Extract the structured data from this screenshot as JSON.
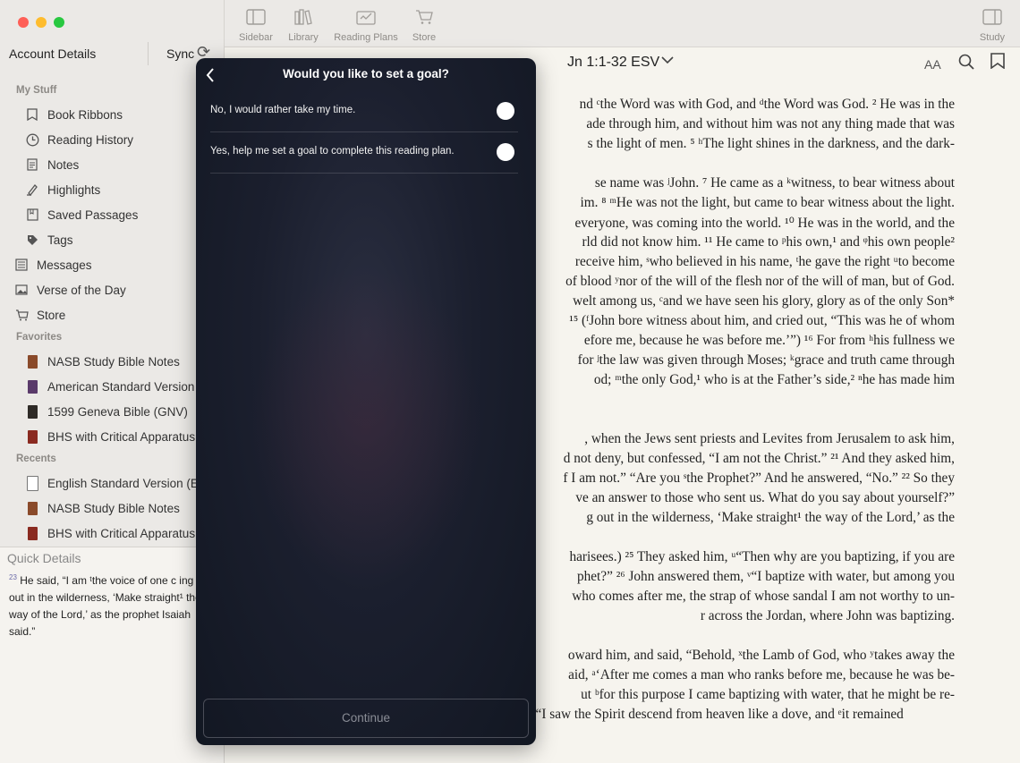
{
  "window": {
    "colors": {
      "close": "#fe5f57",
      "minimize": "#febc2e",
      "zoom": "#28c840"
    }
  },
  "sidebar": {
    "account_label": "Account Details",
    "sync_label": "Sync",
    "my_stuff_heading": "My Stuff",
    "my_stuff": [
      {
        "label": "Book Ribbons",
        "icon": "bookmark-icon"
      },
      {
        "label": "Reading History",
        "icon": "clock-icon"
      },
      {
        "label": "Notes",
        "icon": "notes-icon"
      },
      {
        "label": "Highlights",
        "icon": "highlighter-icon"
      },
      {
        "label": "Saved Passages",
        "icon": "saved-passage-icon"
      },
      {
        "label": "Tags",
        "icon": "tag-icon"
      }
    ],
    "top_items": [
      {
        "label": "Messages",
        "icon": "messages-icon"
      },
      {
        "label": "Verse of the Day",
        "icon": "image-icon"
      },
      {
        "label": "Store",
        "icon": "cart-icon"
      }
    ],
    "favorites_heading": "Favorites",
    "favorites": [
      {
        "label": "NASB Study Bible Notes",
        "color": "#8a4a2a"
      },
      {
        "label": "American Standard Version (A",
        "color": "#5a3a6a"
      },
      {
        "label": "1599 Geneva Bible (GNV)",
        "color": "#2e2a26"
      },
      {
        "label": "BHS with Critical Apparatus a",
        "color": "#8a2a20"
      }
    ],
    "recents_heading": "Recents",
    "recents": [
      {
        "label": "English Standard Version (ES",
        "color": "#ffffff"
      },
      {
        "label": "NASB Study Bible Notes",
        "color": "#8a4a2a"
      },
      {
        "label": "BHS with Critical Apparatus a",
        "color": "#8a2a20"
      }
    ],
    "quick_details": {
      "title": "Quick Details",
      "verse_num": "23",
      "text": "He said, “I am ᵗthe voice of one c ing out in the wilderness, ‘Make straight¹ the way of the Lord,’ as the prophet Isaiah said.”"
    }
  },
  "toolbar": {
    "sidebar": "Sidebar",
    "library": "Library",
    "reading_plans": "Reading Plans",
    "store": "Store",
    "study": "Study"
  },
  "reference": {
    "text": "Jn 1:1-32 ESV"
  },
  "reader": {
    "font_size_label": "AA",
    "lines": [
      "nd ᶜthe Word was with God, and ᵈthe Word was God.   ² He was in the",
      "ade through him, and without him was not any thing made that was",
      "s the light of men.  ⁵  ʰThe light shines in the darkness, and the dark-",
      "",
      "se name was   ʲJohn. ⁷ He came as a   ᵏwitness, to bear witness about",
      "im. ⁸ ᵐHe was not the light, but came to bear witness about the light.",
      "everyone, was coming into the world.  ¹⁰ He was in the world, and the",
      "rld did not know him.  ¹¹ He came to ᵖhis own,¹ and ᵠhis own people²",
      "receive him, ˢwho believed in his name, ᵗhe gave the right ᵘto become",
      "of blood ʸnor of the will of the flesh nor of the will of man, but of God.",
      "welt among us, ᶜand we have seen his glory, glory as of the only Son*",
      "¹⁵ (ᶠJohn bore witness about him, and cried out, “This was he of whom",
      "efore me, because he was before me.’”) ¹⁶ For from   ʰhis fullness we",
      "for ʲthe law was given through Moses; ᵏgrace and truth came through",
      "od; ᵐthe only God,¹ who is at the Father’s side,² ⁿhe has made him",
      "",
      "",
      ", when the Jews sent priests and Levites from Jerusalem to ask him,",
      "d not deny, but confessed, “I am not the Christ.” ²¹ And they asked him,",
      "f I am not.” “Are you ˢthe Prophet?” And he answered, “No.”  ²² So they",
      "ve an answer to those who sent us. What do you say about yourself?”",
      "g out in the wilderness, ‘Make straight¹ the way of the Lord,’ as the",
      "",
      "harisees.)  ²⁵ They asked him, ᵘ“Then why are you baptizing, if you are",
      "phet?” ²⁶ John answered them,    ᵛ“I baptize with water, but among you",
      "who comes after me, the strap of whose sandal I am not worthy to un-",
      "r across the Jordan, where John was baptizing.",
      "",
      "oward him, and said, “Behold, ˣthe Lamb of God, who ʸtakes away the",
      "aid, ᵃ‘After me comes a man who ranks before me, because he was be-",
      "ut ᵇfor this purpose I came baptizing with water, that he might be re-",
      "vealed to Israel.” ³² And John ᶜbore witness: ᵈ“I saw the Spirit descend from heaven like a dove, and ᵉit remained"
    ]
  },
  "dialog": {
    "title": "Would you like to set a goal?",
    "options": [
      {
        "label": "No, I would rather take my time."
      },
      {
        "label": "Yes, help me set a goal to complete this reading plan."
      }
    ],
    "continue_label": "Continue"
  }
}
